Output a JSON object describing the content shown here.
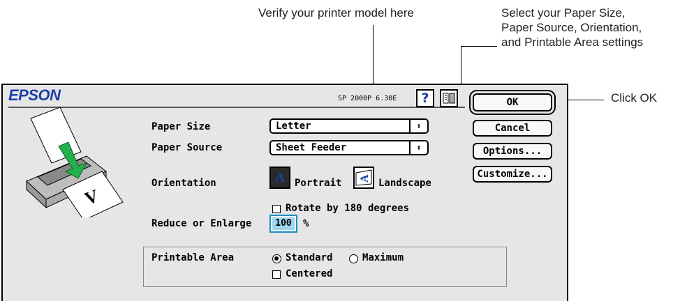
{
  "callouts": {
    "verify_model": "Verify your printer model here",
    "settings_line1": "Select your Paper Size,",
    "settings_line2": "Paper Source, Orientation,",
    "settings_line3": "and Printable Area settings",
    "click_ok": "Click OK"
  },
  "dialog": {
    "brand": "EPSON",
    "version": "SP 2000P 6.30E",
    "buttons": {
      "ok": "OK",
      "cancel": "Cancel",
      "options": "Options...",
      "customize": "Customize..."
    },
    "paper_size": {
      "label": "Paper Size",
      "value": "Letter"
    },
    "paper_source": {
      "label": "Paper Source",
      "value": "Sheet Feeder"
    },
    "orientation": {
      "label": "Orientation",
      "portrait": "Portrait",
      "landscape": "Landscape",
      "selected": "portrait",
      "rotate_label": "Rotate by 180 degrees",
      "rotate_checked": false
    },
    "reduce_enlarge": {
      "label": "Reduce or Enlarge",
      "value": "100",
      "unit": "%"
    },
    "printable_area": {
      "label": "Printable Area",
      "standard": "Standard",
      "maximum": "Maximum",
      "selected": "standard",
      "centered_label": "Centered",
      "centered_checked": false
    },
    "icons": {
      "help": "help-icon",
      "utility": "utility-icon",
      "select_arrows": "up-down-arrows-icon"
    },
    "colors": {
      "brand": "#1c3fa8",
      "percent_highlight": "#9fd6ee"
    }
  }
}
